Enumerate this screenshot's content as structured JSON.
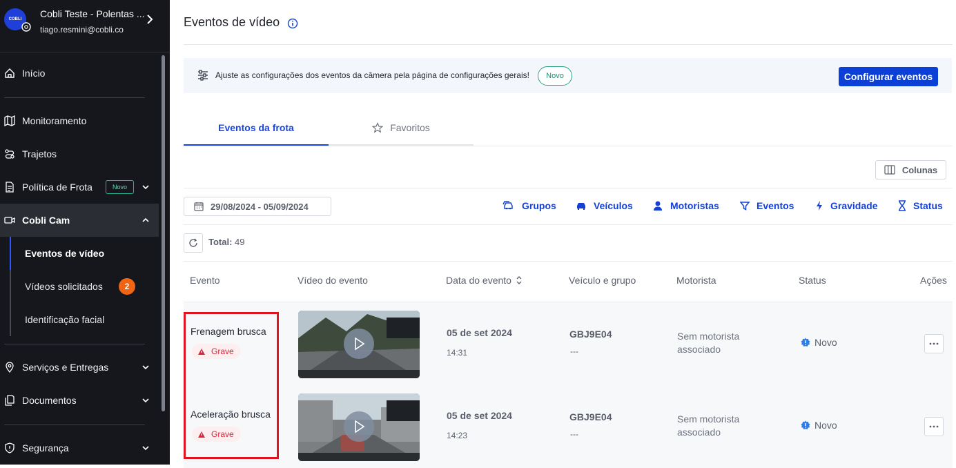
{
  "sidebar": {
    "avatar_text": "COBLI",
    "org_name": "Cobli Teste - Polentas ...",
    "email": "tiago.resmini@cobli.co",
    "items": [
      {
        "label": "Início",
        "icon": "home-icon"
      },
      {
        "label": "Monitoramento",
        "icon": "map-icon"
      },
      {
        "label": "Trajetos",
        "icon": "route-icon"
      },
      {
        "label": "Política de Frota",
        "icon": "document-icon",
        "tag": "Novo"
      },
      {
        "label": "Cobli Cam",
        "icon": "camera-icon"
      },
      {
        "label": "Serviços e Entregas",
        "icon": "location-pin-icon"
      },
      {
        "label": "Documentos",
        "icon": "documents-icon"
      },
      {
        "label": "Segurança",
        "icon": "shield-icon"
      }
    ],
    "sub_items": [
      {
        "label": "Eventos de vídeo"
      },
      {
        "label": "Vídeos solicitados",
        "count": "2"
      },
      {
        "label": "Identificação facial"
      }
    ]
  },
  "header": {
    "title": "Eventos de vídeo"
  },
  "banner": {
    "text": "Ajuste as configurações dos eventos da câmera pela página de configurações gerais!",
    "tag": "Novo",
    "button": "Configurar eventos"
  },
  "tabs": [
    {
      "label": "Eventos da frota",
      "active": true
    },
    {
      "label": "Favoritos",
      "active": false
    }
  ],
  "toolbar": {
    "columns_label": "Colunas",
    "date_range": "29/08/2024 - 05/09/2024",
    "filters": [
      "Grupos",
      "Veículos",
      "Motoristas",
      "Eventos",
      "Gravidade",
      "Status"
    ],
    "total_label": "Total:",
    "total_value": "49"
  },
  "table": {
    "headers": [
      "Evento",
      "Vídeo do evento",
      "Data do evento",
      "Veículo e grupo",
      "Motorista",
      "Status",
      "Ações"
    ],
    "rows": [
      {
        "event": "Frenagem brusca",
        "severity": "Grave",
        "date": "05 de set 2024",
        "time": "14:31",
        "plate": "GBJ9E04",
        "group": "---",
        "driver": "Sem motorista associado",
        "status": "Novo"
      },
      {
        "event": "Aceleração brusca",
        "severity": "Grave",
        "date": "05 de set 2024",
        "time": "14:23",
        "plate": "GBJ9E04",
        "group": "---",
        "driver": "Sem motorista associado",
        "status": "Novo"
      }
    ]
  },
  "colors": {
    "sidebar_bg": "#15171c",
    "primary": "#0b3fd6",
    "severity_red": "#d6283a",
    "badge_orange": "#f06414",
    "highlight_red": "#e0141e"
  }
}
